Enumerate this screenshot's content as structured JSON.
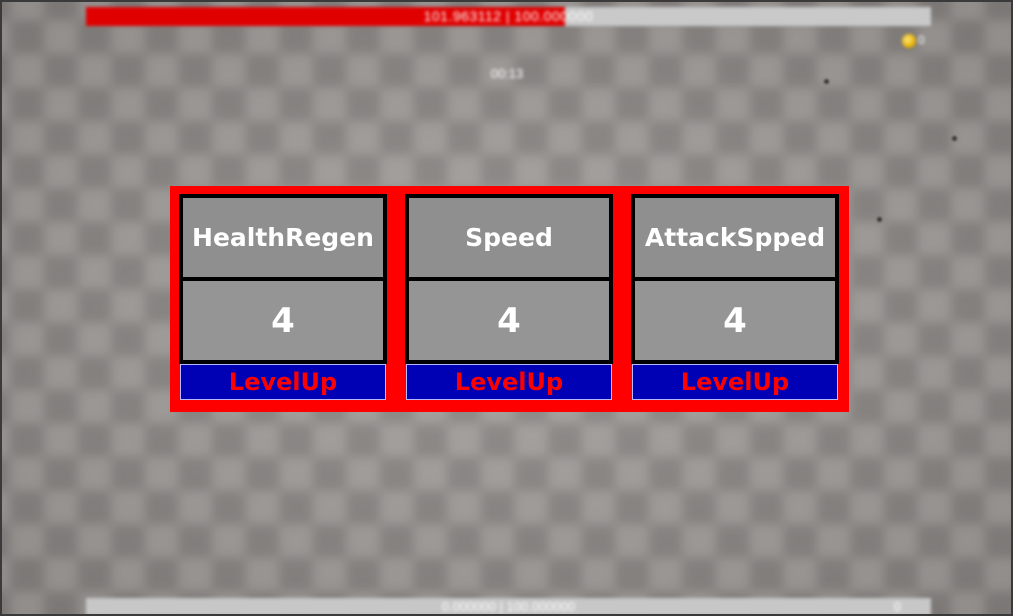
{
  "hud": {
    "health_text": "101.963112 | 100.000000",
    "health_fraction": 0.567,
    "health_color": "#e10000",
    "timer_text": "00:13",
    "coin_icon": "coin-icon",
    "coin_text": "0",
    "bottom_text": "0.000000 | 100.000000",
    "bottom_right_text": "0"
  },
  "levelup": {
    "panel_color": "#ff0000",
    "button_color": "#0000b4",
    "stats": [
      {
        "name": "HealthRegen",
        "level": "4",
        "button_label": "LevelUp"
      },
      {
        "name": "Speed",
        "level": "4",
        "button_label": "LevelUp"
      },
      {
        "name": "AttackSpped",
        "level": "4",
        "button_label": "LevelUp"
      }
    ]
  }
}
